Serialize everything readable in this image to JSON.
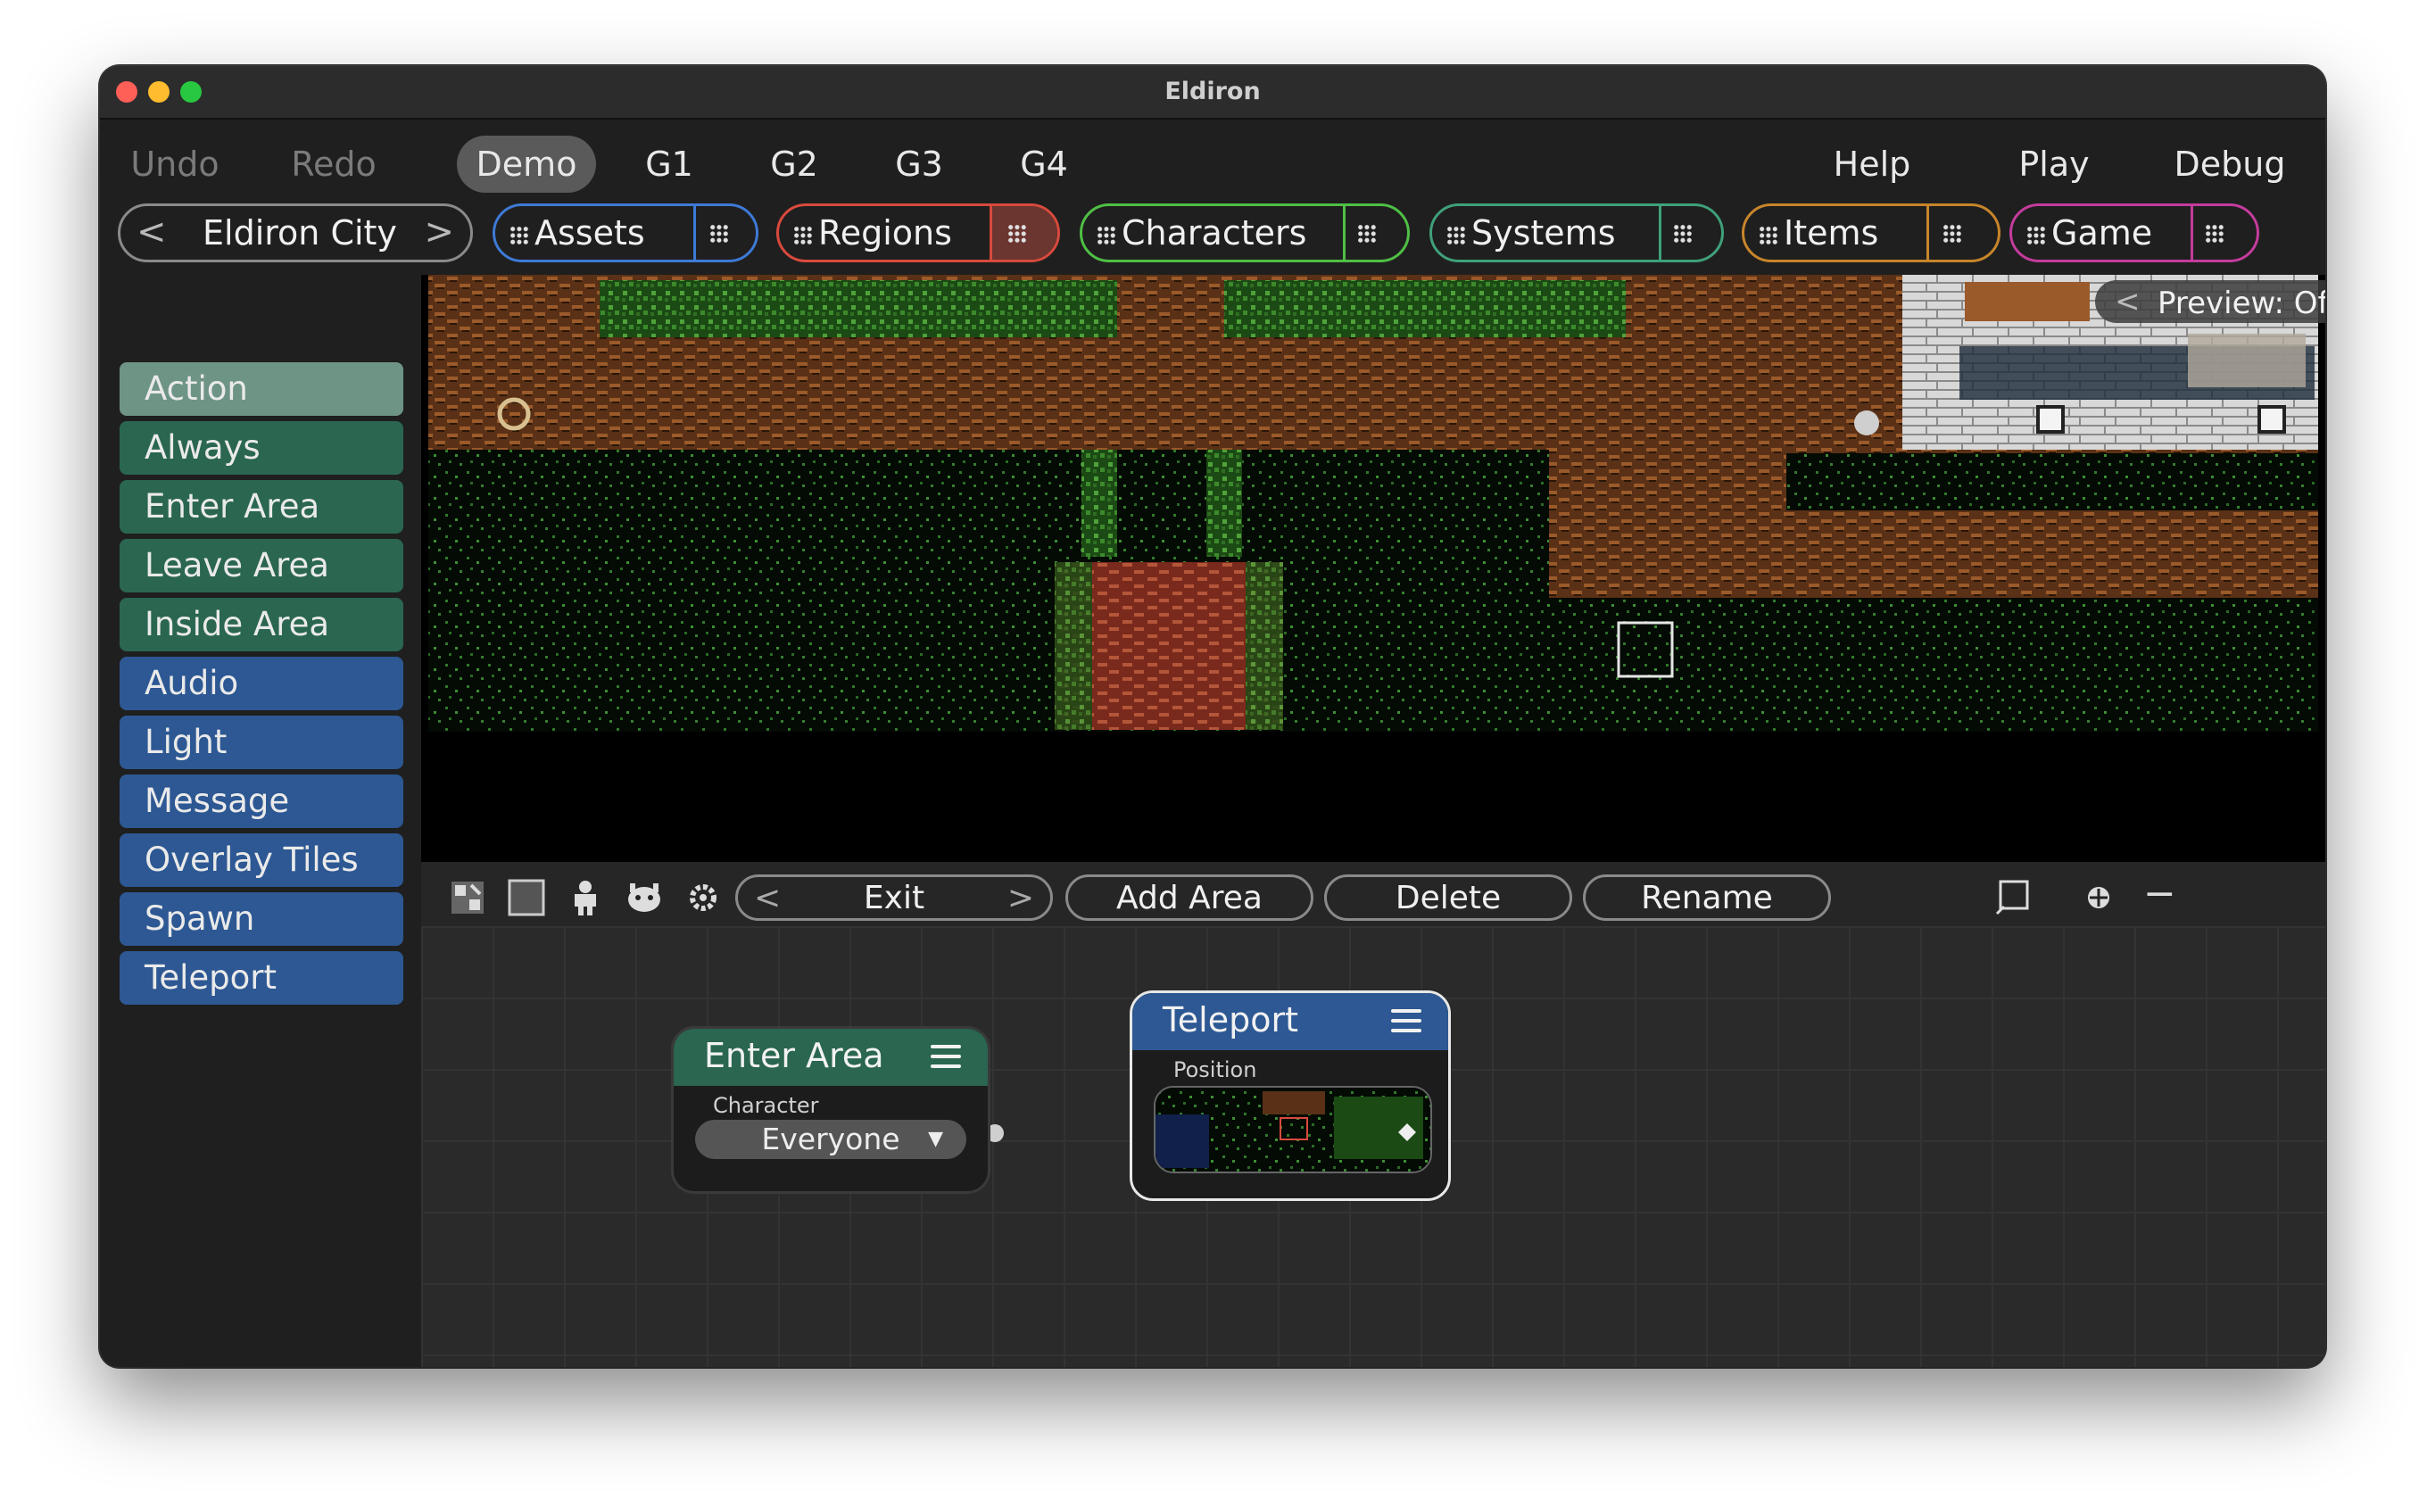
{
  "window": {
    "title": "Eldiron"
  },
  "menu": {
    "undo": "Undo",
    "redo": "Redo",
    "demo": "Demo",
    "g1": "G1",
    "g2": "G2",
    "g3": "G3",
    "g4": "G4",
    "help": "Help",
    "play": "Play",
    "debug": "Debug"
  },
  "tabs": {
    "region_name": "Eldiron City",
    "items": [
      {
        "label": "Assets",
        "color": "#3d7ad6"
      },
      {
        "label": "Regions",
        "color": "#d84a3d"
      },
      {
        "label": "Characters",
        "color": "#4fbf45"
      },
      {
        "label": "Systems",
        "color": "#3fa07a"
      },
      {
        "label": "Items",
        "color": "#c7852b"
      },
      {
        "label": "Game",
        "color": "#c43c9c"
      }
    ]
  },
  "sidebar": {
    "items": [
      {
        "label": "Action",
        "group": "selected"
      },
      {
        "label": "Always",
        "group": "green"
      },
      {
        "label": "Enter Area",
        "group": "green"
      },
      {
        "label": "Leave Area",
        "group": "green"
      },
      {
        "label": "Inside Area",
        "group": "green"
      },
      {
        "label": "Audio",
        "group": "blue"
      },
      {
        "label": "Light",
        "group": "blue"
      },
      {
        "label": "Message",
        "group": "blue"
      },
      {
        "label": "Overlay Tiles",
        "group": "blue"
      },
      {
        "label": "Spawn",
        "group": "blue"
      },
      {
        "label": "Teleport",
        "group": "blue"
      }
    ]
  },
  "map": {
    "preview": "Preview: Off"
  },
  "toolbar": {
    "area": "Exit",
    "add_area": "Add Area",
    "delete": "Delete",
    "rename": "Rename",
    "zoom_out": "−"
  },
  "nodes": {
    "enter_area": {
      "title": "Enter Area",
      "param_label": "Character",
      "value": "Everyone",
      "color": "#2a6650"
    },
    "teleport": {
      "title": "Teleport",
      "param_label": "Position",
      "color": "#2d5893"
    }
  }
}
